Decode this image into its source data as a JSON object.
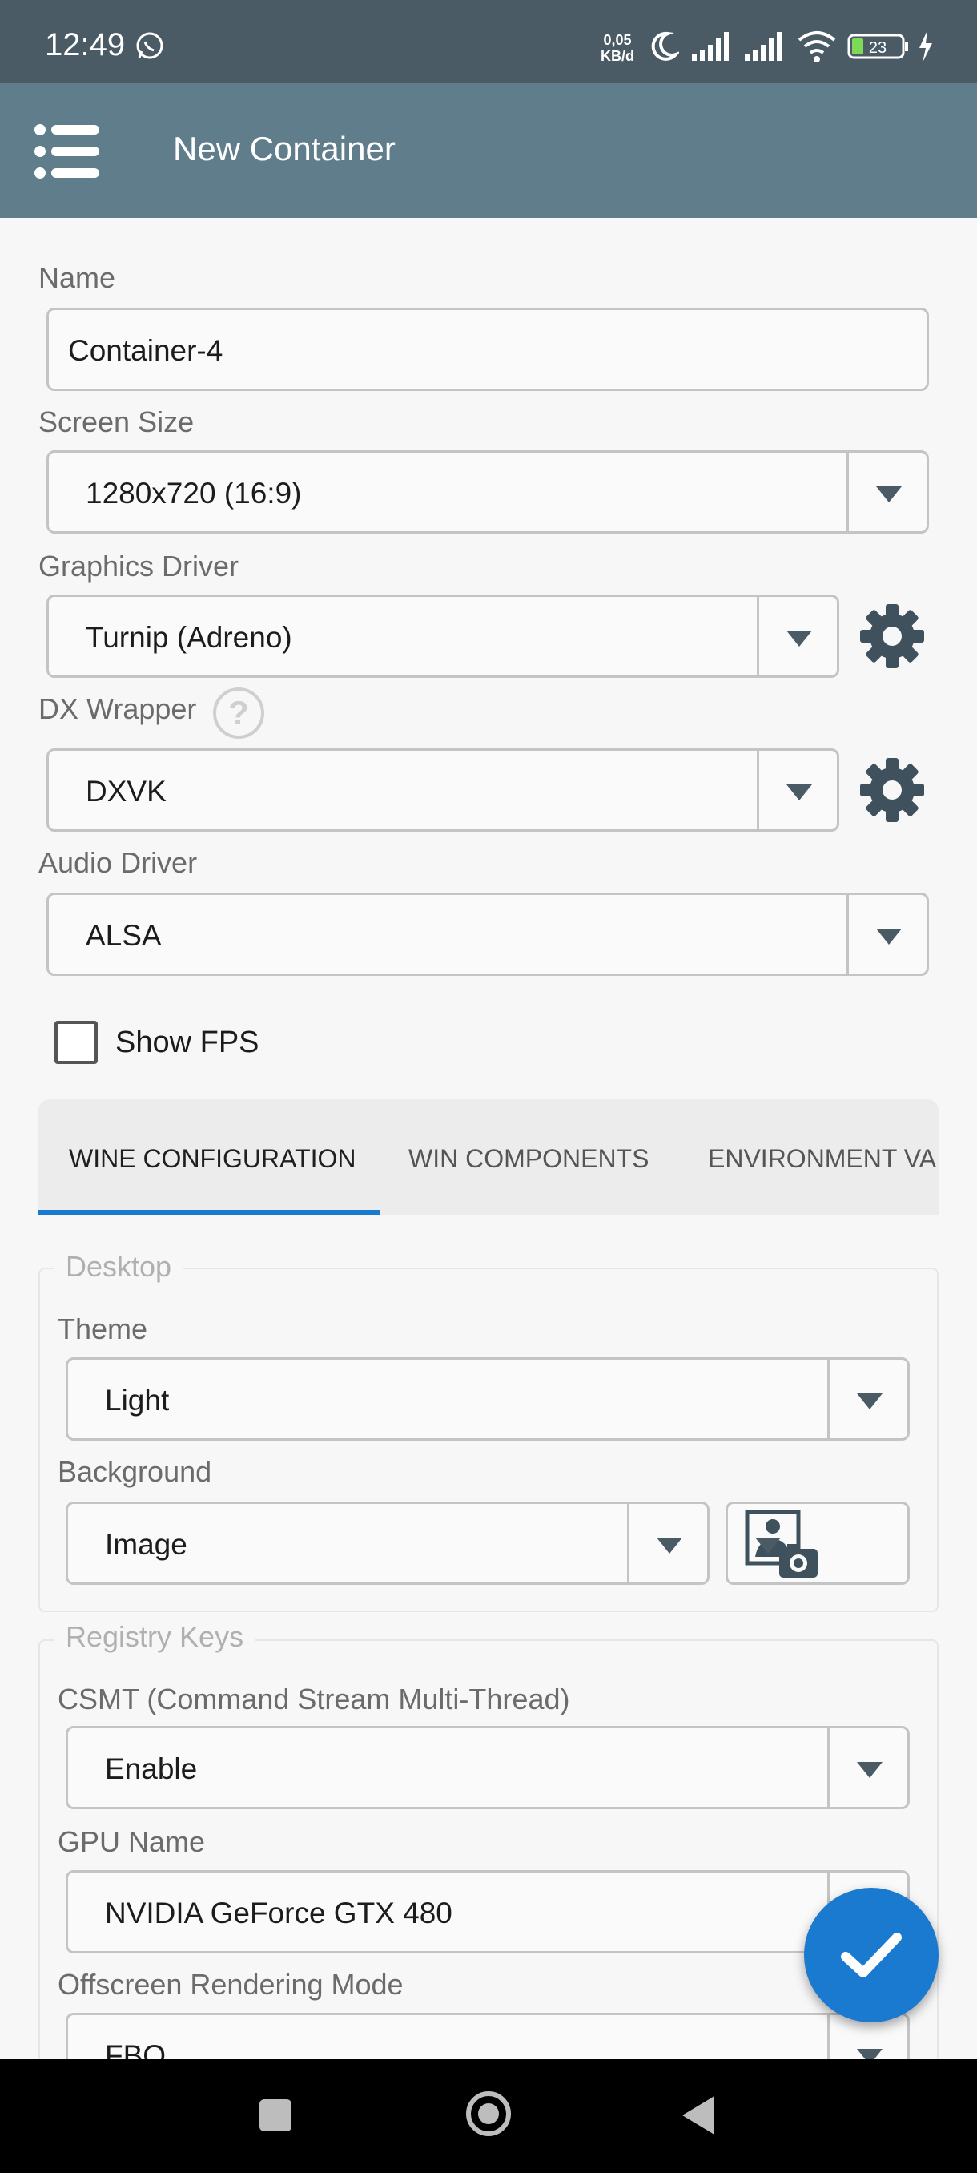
{
  "status_bar": {
    "time": "12:49",
    "net_rate_value": "0,05",
    "net_rate_unit": "KB/d",
    "battery_level": "23"
  },
  "app_bar": {
    "title": "New Container"
  },
  "form": {
    "name": {
      "label": "Name",
      "value": "Container-4"
    },
    "screen_size": {
      "label": "Screen Size",
      "value": "1280x720 (16:9)"
    },
    "graphics_driver": {
      "label": "Graphics Driver",
      "value": "Turnip (Adreno)"
    },
    "dx_wrapper": {
      "label": "DX Wrapper",
      "help": "?",
      "value": "DXVK"
    },
    "audio_driver": {
      "label": "Audio Driver",
      "value": "ALSA"
    },
    "show_fps": {
      "label": "Show FPS",
      "checked": false
    }
  },
  "tabs": [
    {
      "label": "WINE CONFIGURATION",
      "active": true
    },
    {
      "label": "WIN COMPONENTS",
      "active": false
    },
    {
      "label": "ENVIRONMENT VA",
      "active": false
    }
  ],
  "desktop": {
    "legend": "Desktop",
    "theme": {
      "label": "Theme",
      "value": "Light"
    },
    "background": {
      "label": "Background",
      "value": "Image"
    }
  },
  "registry": {
    "legend": "Registry Keys",
    "csmt": {
      "label": "CSMT (Command Stream Multi-Thread)",
      "value": "Enable"
    },
    "gpu_name": {
      "label": "GPU Name",
      "value": "NVIDIA GeForce GTX 480"
    },
    "offscreen": {
      "label": "Offscreen Rendering Mode",
      "value": "FBO"
    }
  },
  "colors": {
    "status_bar": "#4a5b66",
    "app_bar": "#607d8b",
    "accent": "#1a7ad0"
  }
}
